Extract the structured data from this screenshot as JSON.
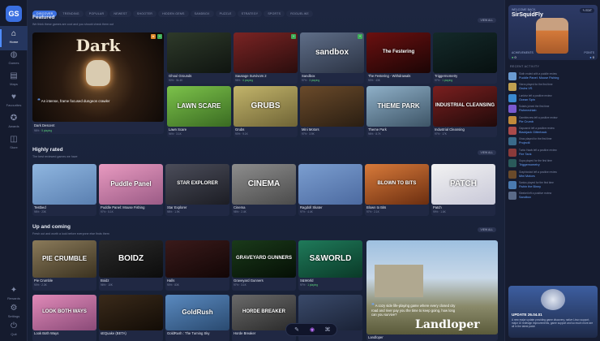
{
  "app": {
    "logo_text": "GS"
  },
  "rail": {
    "items": [
      {
        "label": "Home",
        "icon": "⌂",
        "name": "home-icon"
      },
      {
        "label": "Games",
        "icon": "◍",
        "name": "gamepad-icon"
      },
      {
        "label": "Maps",
        "icon": "▤",
        "name": "map-icon"
      },
      {
        "label": "Favourites",
        "icon": "♥",
        "name": "heart-icon"
      },
      {
        "label": "Awards",
        "icon": "✪",
        "name": "award-icon"
      },
      {
        "label": "Store",
        "icon": "◫",
        "name": "store-icon"
      }
    ],
    "bottom": [
      {
        "label": "Rewards",
        "icon": "✦",
        "name": "rewards-icon"
      },
      {
        "label": "Settings",
        "icon": "⚙",
        "name": "gear-icon"
      },
      {
        "label": "Quit",
        "icon": "⏻",
        "name": "power-icon"
      }
    ]
  },
  "tabs": [
    "Discover",
    "Trending",
    "Popular",
    "Newest",
    "Shooter",
    "Hidden Gems",
    "Sandbox",
    "Puzzle",
    "Strategy",
    "Sports",
    "Roguelike"
  ],
  "featured": {
    "title": "Featured",
    "subtitle": "We think these games are cool and you should check them out",
    "view_all": "VIEW ALL",
    "hero": {
      "name": "Dark Descent",
      "quote": "An intense, frame focused dungeon crawler",
      "meta": "96%",
      "players": "5 playing",
      "thumb_text": "Dark"
    },
    "games": [
      {
        "name": "Ghoul Grounds",
        "meta": "90%",
        "count": "5k 4K",
        "thumb_text": "",
        "bg": "linear-gradient(160deg,#2e3a2a,#0f1410)"
      },
      {
        "name": "Sausage Survivors 2",
        "meta": "96%",
        "players": "6 playing",
        "thumb_text": "",
        "bg": "linear-gradient(160deg,#7a2424,#2a0d0d)"
      },
      {
        "name": "Sandbox",
        "meta": "97%",
        "players": "3 playing",
        "thumb_text": "sandbox",
        "bg": "linear-gradient(160deg,#5f6e88,#2b3344)"
      },
      {
        "name": "The Festering - Withdrawals",
        "meta": "90%",
        "count": "43K",
        "thumb_text": "The Festering",
        "bg": "linear-gradient(160deg,#6b1010,#1b0505)"
      },
      {
        "name": "Triggernometry",
        "meta": "97%",
        "players": "1 playing",
        "thumb_text": "",
        "bg": "linear-gradient(160deg,#142a2a,#071010)"
      },
      {
        "name": "Lawn Scare",
        "meta": "94%",
        "count": "3.1K",
        "thumb_text": "LAWN SCARE",
        "bg": "linear-gradient(160deg,#7cc24a,#3a6b22)"
      },
      {
        "name": "Grubs",
        "meta": "90%",
        "count": "9.1K",
        "thumb_text": "GRUBS",
        "bg": "linear-gradient(160deg,#c2b46a,#6f6436)"
      },
      {
        "name": "Mini Motors",
        "meta": "97%",
        "count": "3.9K",
        "thumb_text": "",
        "bg": "linear-gradient(160deg,#6a4a2a,#2a1e12)"
      },
      {
        "name": "Theme Park",
        "meta": "96%",
        "count": "8.7K",
        "thumb_text": "THEME PARK",
        "bg": "linear-gradient(160deg,#8fb0c8,#3d5466)"
      },
      {
        "name": "Industrial Cleansing",
        "meta": "97%",
        "count": "17K",
        "thumb_text": "INDUSTRIAL CLEANSING",
        "bg": "linear-gradient(160deg,#7a1f1f,#1f0a0a)"
      }
    ]
  },
  "highly_rated": {
    "title": "Highly rated",
    "subtitle": "The best reviewed games we have",
    "view_all": "VIEW ALL",
    "games": [
      {
        "name": "Testbed",
        "meta": "98%",
        "count": "23K",
        "thumb_text": "",
        "bg": "linear-gradient(160deg,#8fb6e0,#5a7fb0)"
      },
      {
        "name": "Puddle Panel: Mouse Fishing",
        "meta": "97%",
        "count": "5.1K",
        "thumb_text": "Puddle Panel",
        "bg": "linear-gradient(160deg,#e89ac0,#9b5b86)"
      },
      {
        "name": "Star Explorer",
        "meta": "98%",
        "count": "1.9K",
        "thumb_text": "STAR EXPLORER",
        "bg": "linear-gradient(160deg,#4b4d5a,#1c1d24)"
      },
      {
        "name": "Cinema",
        "meta": "98%",
        "count": "2.4K",
        "thumb_text": "CINEMA",
        "bg": "linear-gradient(160deg,#8d8d8d,#4b4b4b)"
      },
      {
        "name": "Ragdoll Skater",
        "meta": "97%",
        "count": "4.4K",
        "thumb_text": "",
        "bg": "linear-gradient(160deg,#7b9ed0,#4c6aa0)"
      },
      {
        "name": "Blown to Bits",
        "meta": "97%",
        "count": "2.1K",
        "thumb_text": "BLOWN TO BITS",
        "bg": "linear-gradient(160deg,#d87a3a,#6b2e10)"
      },
      {
        "name": "Patch",
        "meta": "99%",
        "count": "1.6K",
        "thumb_text": "PATCH",
        "bg": "linear-gradient(160deg,#f2f2f2,#c8c8d8)"
      }
    ]
  },
  "up_and_coming": {
    "title": "Up and coming",
    "subtitle": "Fresh out and worth a look before everyone else finds them",
    "view_all": "VIEW ALL",
    "games": [
      {
        "name": "Pie Crumble",
        "meta": "90%",
        "count": "2.3K",
        "thumb_text": "PIE CRUMBLE",
        "bg": "linear-gradient(160deg,#8a7a5a,#3b3220)"
      },
      {
        "name": "Boidz",
        "meta": "96%",
        "count": "10K",
        "thumb_text": "BOIDZ",
        "bg": "linear-gradient(160deg,#2a2a2a,#0c0c0c)"
      },
      {
        "name": "Halls",
        "meta": "90%",
        "count": "83K",
        "thumb_text": "",
        "bg": "linear-gradient(160deg,#3a1a1a,#120606)"
      },
      {
        "name": "Graveyard Gunners",
        "meta": "97%",
        "count": "3.1K",
        "thumb_text": "GRAVEYARD GUNNERS",
        "bg": "linear-gradient(160deg,#1a3a1a,#050f05)"
      },
      {
        "name": "S&World",
        "meta": "97%",
        "players": "1 playing",
        "thumb_text": "S&WORLD",
        "bg": "linear-gradient(160deg,#1f7a5a,#0a3a28)"
      },
      {
        "name": "Look Both Ways",
        "meta": "",
        "thumb_text": "LOOK BOTH WAYS",
        "bg": "linear-gradient(160deg,#e08ab8,#8a4a78)"
      },
      {
        "name": "sEQuake (BETA)",
        "meta": "",
        "thumb_text": "",
        "bg": "linear-gradient(160deg,#3a2a1a,#120c06)"
      },
      {
        "name": "GoldRush : The Turning Sky",
        "meta": "",
        "thumb_text": "GoldRush",
        "bg": "linear-gradient(160deg,#5a8ac0,#2a4a70)"
      },
      {
        "name": "Horde Breaker",
        "meta": "",
        "thumb_text": "HORDE BREAKER",
        "bg": "linear-gradient(160deg,#6a6a6a,#2a2a2a)"
      },
      {
        "name": "",
        "meta": "",
        "thumb_text": "",
        "bg": "linear-gradient(160deg,#3a4a6a,#1a2236)"
      }
    ],
    "hero": {
      "name": "Landloper",
      "quote": "A cozy side life-playing game where every closed city road and river pay you the time to keep going, how long can you survive?",
      "thumb_text": "Landloper"
    }
  },
  "profile": {
    "welcome": "WELCOME BACK,",
    "username": "SirSquidFly",
    "edit": "EDIT",
    "stat1_label": "ACHIEVEMENTS",
    "stat1_value": "0",
    "stat2_label": "POINTS",
    "stat2_value": "0"
  },
  "recent": {
    "title": "RECENT ACTIVITY",
    "items": [
      {
        "t1": "Sloth ended with a puddle review",
        "t2": "Puddle Panel: Mouse Fishing",
        "color": "#6a9ad0"
      },
      {
        "t1": "Vierra played for the first time",
        "t2": "Grubs VS",
        "color": "#c0a050"
      },
      {
        "t1": "Lunkinz left a positive review",
        "t2": "Ocean Spin",
        "color": "#3a8ad0"
      },
      {
        "t1": "Solaris joined the first time",
        "t2": "Fishmechlab",
        "color": "#7a5ad0"
      },
      {
        "t1": "Gamblecrew left a positive review",
        "t2": "Pie Crumb",
        "color": "#c08a3a"
      },
      {
        "t1": "Gapcarrot left a positive review",
        "t2": "Blackjack Gitterback",
        "color": "#aa4a4a"
      },
      {
        "t1": "Xiros played for the first time",
        "t2": "Projectil",
        "color": "#3a6a8a"
      },
      {
        "t1": "Turbo Hawk left a positive review",
        "t2": "Fire Tank",
        "color": "#8a3a3a"
      },
      {
        "t1": "Gupa played for the first time",
        "t2": "Triggernometry",
        "color": "#2a5a5a"
      },
      {
        "t1": "Graphicsbot left a positive review",
        "t2": "Mini Motors",
        "color": "#6a4a2a"
      },
      {
        "t1": "Sanlus played for the first time",
        "t2": "Fishin the Binny",
        "color": "#4a7ab0"
      },
      {
        "t1": "Sleeket left a positive review",
        "t2": "Sandbox",
        "color": "#5a6a88"
      }
    ]
  },
  "feature_box": {
    "title": "UPDATE 26.04.01",
    "text": "A new major update providing game discovery, native Linux support, major UI redesign improvements, game support and so much more are all in the latest patch"
  },
  "bottombar": [
    {
      "icon": "✎",
      "name": "edit-icon"
    },
    {
      "icon": "◉",
      "name": "avatar-icon"
    },
    {
      "icon": "⌘",
      "name": "people-icon"
    }
  ]
}
